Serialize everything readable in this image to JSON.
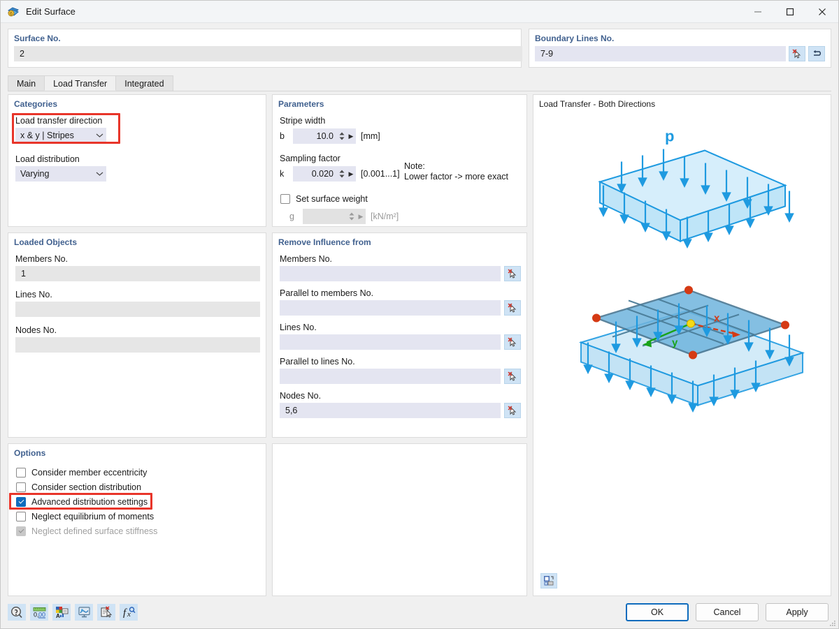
{
  "window": {
    "title": "Edit Surface",
    "app_icon": "surface-icon",
    "minimize": "—",
    "maximize": "□",
    "close": "✕"
  },
  "surface_panel": {
    "title": "Surface No.",
    "value": "2"
  },
  "boundary_panel": {
    "title": "Boundary Lines No.",
    "value": "7-9",
    "pick_button_icon": "pick-cursor-icon",
    "back_button_icon": "undo-arrow-icon"
  },
  "tabs": [
    {
      "label": "Main",
      "active": false
    },
    {
      "label": "Load Transfer",
      "active": true
    },
    {
      "label": "Integrated",
      "active": false
    }
  ],
  "categories": {
    "title": "Categories",
    "direction_label": "Load transfer direction",
    "direction_value": "x & y | Stripes",
    "direction_options": [
      "x & y | Stripes"
    ],
    "distribution_label": "Load distribution",
    "distribution_value": "Varying",
    "distribution_options": [
      "Varying"
    ],
    "highlight_color": "#e8352a"
  },
  "parameters": {
    "title": "Parameters",
    "stripe_width_label": "Stripe width",
    "stripe_width_symbol": "b",
    "stripe_width_value": "10.0",
    "stripe_width_unit": "[mm]",
    "sampling_factor_label": "Sampling factor",
    "sampling_factor_symbol": "k",
    "sampling_factor_value": "0.020",
    "sampling_factor_range": "[0.001...1]",
    "note_title": "Note:",
    "note_text": "Lower factor -> more exact",
    "surface_weight_label": "Set surface weight",
    "surface_weight_checked": false,
    "surface_weight_symbol": "g",
    "surface_weight_value": "",
    "surface_weight_unit": "[kN/m²]"
  },
  "loaded_objects": {
    "title": "Loaded Objects",
    "fields": [
      {
        "label": "Members No.",
        "value": "1"
      },
      {
        "label": "Lines No.",
        "value": ""
      },
      {
        "label": "Nodes No.",
        "value": ""
      }
    ]
  },
  "remove_influence": {
    "title": "Remove Influence from",
    "fields": [
      {
        "label": "Members No.",
        "value": "",
        "button_icon": "pick-cursor-icon"
      },
      {
        "label": "Parallel to members No.",
        "value": "",
        "button_icon": "pick-cursor-icon"
      },
      {
        "label": "Lines No.",
        "value": "",
        "button_icon": "pick-cursor-icon"
      },
      {
        "label": "Parallel to lines No.",
        "value": "",
        "button_icon": "pick-cursor-icon"
      },
      {
        "label": "Nodes No.",
        "value": "5,6",
        "button_icon": "pick-cursor-icon"
      }
    ]
  },
  "options": {
    "title": "Options",
    "items": [
      {
        "label": "Consider member eccentricity",
        "checked": false,
        "disabled": false,
        "highlighted": false
      },
      {
        "label": "Consider section distribution",
        "checked": false,
        "disabled": false,
        "highlighted": false
      },
      {
        "label": "Advanced distribution settings",
        "checked": true,
        "disabled": false,
        "highlighted": true
      },
      {
        "label": "Neglect equilibrium of moments",
        "checked": false,
        "disabled": false,
        "highlighted": false
      },
      {
        "label": "Neglect defined surface stiffness",
        "checked": true,
        "disabled": true,
        "highlighted": false
      }
    ]
  },
  "preview": {
    "title": "Load Transfer - Both Directions",
    "load_symbol": "p",
    "axis_x_label": "x",
    "axis_y_label": "y",
    "image_button_icon": "insert-picture-icon"
  },
  "footer": {
    "tools": [
      {
        "name": "help-info-icon"
      },
      {
        "name": "units-decimals-icon"
      },
      {
        "name": "display-properties-icon"
      },
      {
        "name": "visualization-icon"
      },
      {
        "name": "comment-pick-icon"
      },
      {
        "name": "formula-icon"
      }
    ],
    "buttons": [
      {
        "label": "OK",
        "primary": true
      },
      {
        "label": "Cancel",
        "primary": false
      },
      {
        "label": "Apply",
        "primary": false
      }
    ]
  }
}
